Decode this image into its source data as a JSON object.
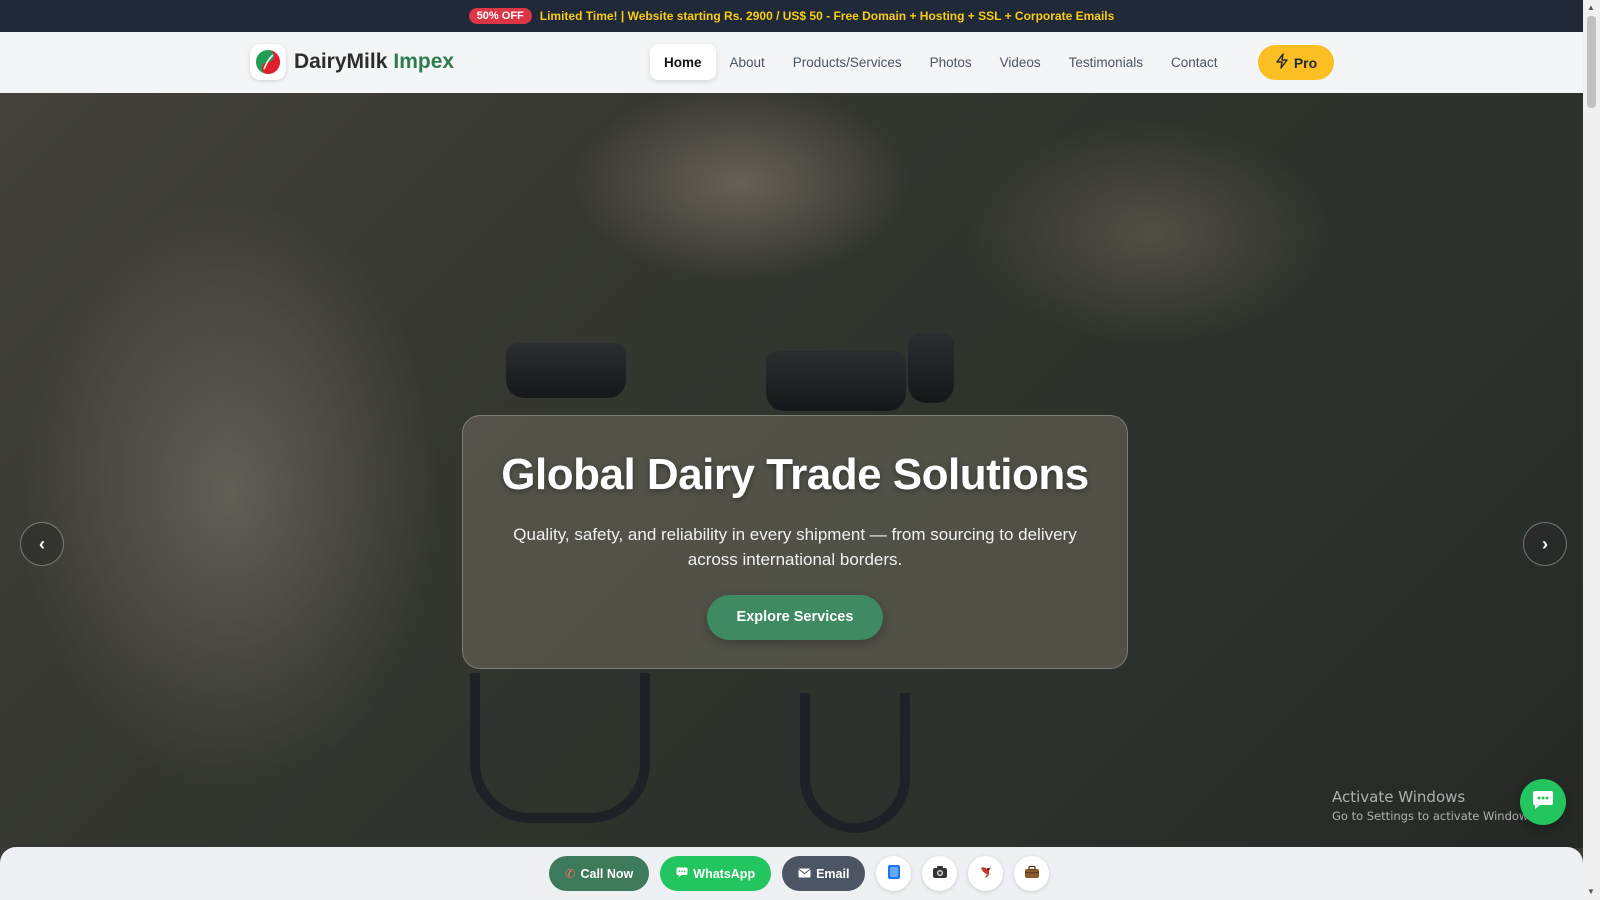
{
  "promo": {
    "badge": "50% OFF",
    "text": "Limited Time! | Website starting Rs. 2900 / US$ 50 - Free Domain + Hosting + SSL + Corporate Emails"
  },
  "brand": {
    "name": "DairyMilk",
    "accent": "Impex"
  },
  "nav": {
    "items": [
      {
        "label": "Home",
        "active": true
      },
      {
        "label": "About"
      },
      {
        "label": "Products/Services"
      },
      {
        "label": "Photos"
      },
      {
        "label": "Videos"
      },
      {
        "label": "Testimonials"
      },
      {
        "label": "Contact"
      }
    ],
    "pro_label": "Pro",
    "pro_icon": "lightning-icon"
  },
  "hero": {
    "title": "Global Dairy Trade Solutions",
    "subtitle": "Quality, safety, and reliability in every shipment — from sourcing to delivery across international borders.",
    "cta": "Explore Services",
    "prev_icon": "chevron-left-icon",
    "next_icon": "chevron-right-icon"
  },
  "watermark": {
    "title": "Activate Windows",
    "subtitle": "Go to Settings to activate Windows."
  },
  "bottom_bar": {
    "call": "Call Now",
    "whatsapp": "WhatsApp",
    "email": "Email",
    "icons": [
      "facebook-icon",
      "instagram-icon",
      "bird-icon",
      "briefcase-icon"
    ]
  },
  "colors": {
    "brand_green": "#2f7d4e",
    "promo_yellow": "#facc15",
    "pro_yellow": "#fbbf24",
    "whatsapp_green": "#22c55e",
    "badge_red": "#dc3545"
  }
}
